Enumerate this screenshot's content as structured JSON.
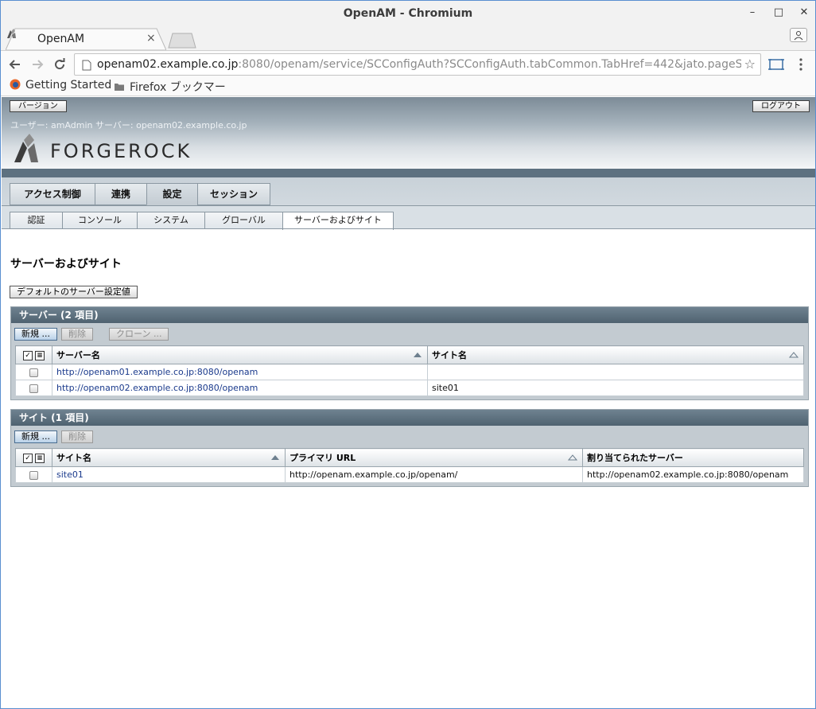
{
  "window": {
    "title": "OpenAM - Chromium",
    "minimize": "–",
    "maximize": "□",
    "close": "✕"
  },
  "tab": {
    "title": "OpenAM",
    "close": "×"
  },
  "address": {
    "host": "openam02.example.co.jp",
    "rest": ":8080/openam/service/SCConfigAuth?SCConfigAuth.tabCommon.TabHref=442&jato.pageSession=AKztAA"
  },
  "bookmarks": {
    "items": [
      "Getting Started",
      "Firefox ブックマー"
    ]
  },
  "masthead": {
    "version_button": "バージョン",
    "logout_button": "ログアウト",
    "user_info": "ユーザー: amAdmin   サーバー: openam02.example.co.jp",
    "brand": "FORGEROCK"
  },
  "main_tabs": [
    "アクセス制御",
    "連携",
    "設定",
    "セッション"
  ],
  "sub_tabs": [
    "認証",
    "コンソール",
    "システム",
    "グローバル",
    "サーバーおよびサイト"
  ],
  "page": {
    "title": "サーバーおよびサイト",
    "default_server_button": "デフォルトのサーバー設定値"
  },
  "servers": {
    "heading": "サーバー (2 項目)",
    "buttons": {
      "new": "新規 ...",
      "delete": "削除",
      "clone": "クローン ..."
    },
    "columns": [
      "サーバー名",
      "サイト名"
    ],
    "rows": [
      {
        "name": "http://openam01.example.co.jp:8080/openam",
        "site": ""
      },
      {
        "name": "http://openam02.example.co.jp:8080/openam",
        "site": "site01"
      }
    ]
  },
  "sites": {
    "heading": "サイト (1 項目)",
    "buttons": {
      "new": "新規 ...",
      "delete": "削除"
    },
    "columns": [
      "サイト名",
      "プライマリ URL",
      "割り当てられたサーバー"
    ],
    "rows": [
      {
        "name": "site01",
        "url": "http://openam.example.co.jp/openam/",
        "servers": "http://openam02.example.co.jp:8080/openam"
      }
    ]
  }
}
